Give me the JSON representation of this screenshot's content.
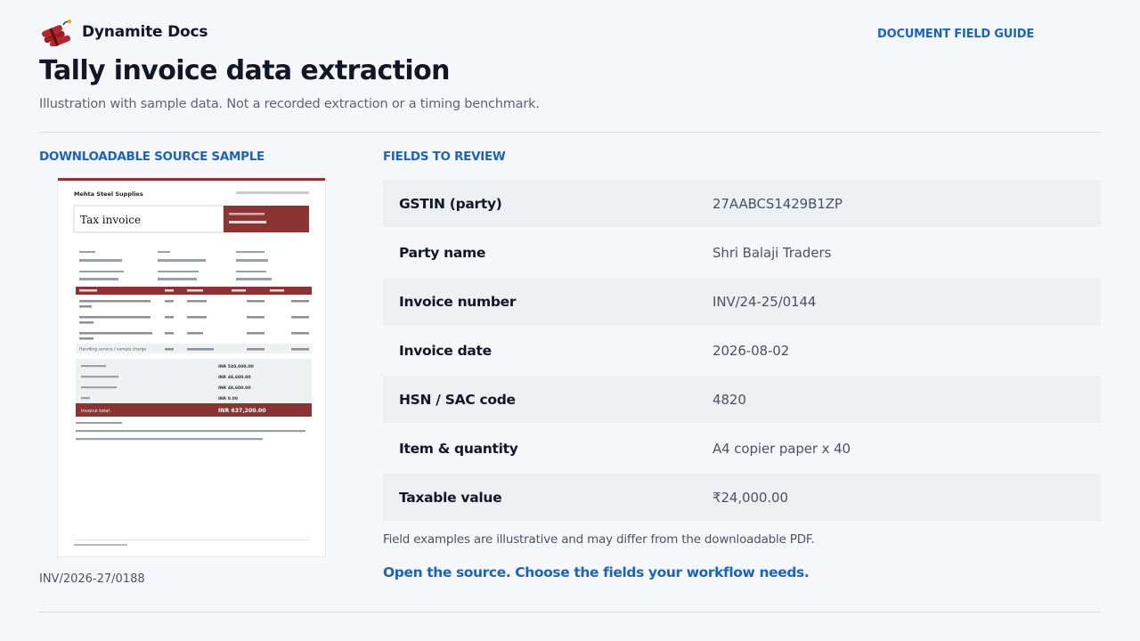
{
  "header": {
    "brand_name": "Dynamite Docs",
    "guide_link": "DOCUMENT FIELD GUIDE"
  },
  "page": {
    "title": "Tally invoice data extraction",
    "subtitle": "Illustration with sample data. Not a recorded extraction or a timing benchmark."
  },
  "left": {
    "section_label": "DOWNLOADABLE SOURCE SAMPLE",
    "doc_caption": "INV/2026-27/0188"
  },
  "doc": {
    "company": "Mehta Steel Supplies",
    "title": "Tax invoice",
    "total_label": "Invoice total",
    "total_value": "INR 637,200.00",
    "subtotal_values": [
      "INR 540,000.00",
      "INR 48,600.00",
      "INR 48,600.00",
      "INR 0.00"
    ],
    "line_item": "Handling service / sample charge"
  },
  "right": {
    "section_label": "FIELDS TO REVIEW",
    "fields": [
      {
        "label": "GSTIN (party)",
        "value": "27AABCS1429B1ZP"
      },
      {
        "label": "Party name",
        "value": "Shri Balaji Traders"
      },
      {
        "label": "Invoice number",
        "value": "INV/24-25/0144"
      },
      {
        "label": "Invoice date",
        "value": "2026-08-02"
      },
      {
        "label": "HSN / SAC code",
        "value": "4820"
      },
      {
        "label": "Item & quantity",
        "value": "A4 copier paper x 40"
      },
      {
        "label": "Taxable value",
        "value": "₹24,000.00"
      }
    ],
    "footnote": "Field examples are illustrative and may differ from the downloadable PDF.",
    "cta": "Open the source. Choose the fields your workflow needs."
  },
  "colors": {
    "accent": "#1f63b8",
    "brand_red": "#8b3434",
    "row_shade": "#edf0f3"
  }
}
